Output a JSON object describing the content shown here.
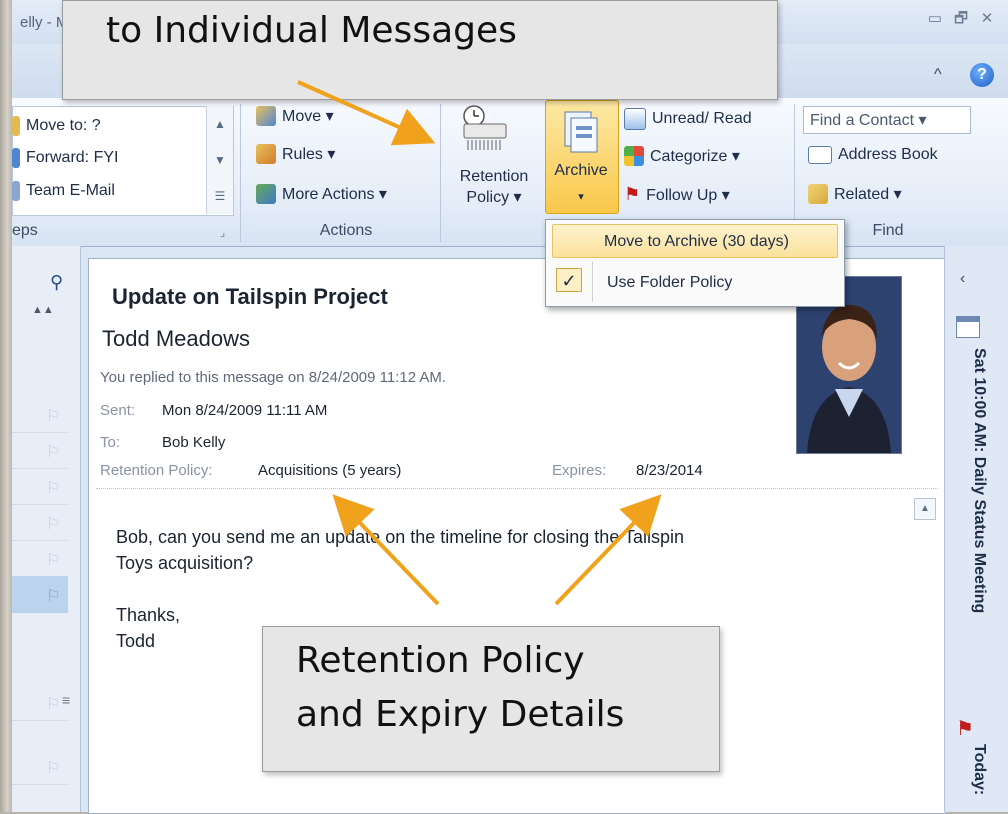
{
  "window": {
    "title_partial": "elly - Microsoft Outlook",
    "minimize_glyph": "▭",
    "restore_glyph": "🗗",
    "close_glyph": "✕",
    "help_glyph": "?",
    "collapse_glyph": "^"
  },
  "ribbon": {
    "quick_steps": {
      "items": [
        "Move to: ?",
        "Forward: FYI",
        "Team E-Mail"
      ],
      "group_label": "eps"
    },
    "actions": {
      "items": [
        "Move ▾",
        "Rules ▾",
        "More Actions ▾"
      ],
      "group_label": "Actions"
    },
    "retention_policy": {
      "line1": "Retention",
      "line2": "Policy ▾"
    },
    "archive": {
      "label": "Archive",
      "arrow": "▾"
    },
    "tags": {
      "items": [
        "Unread/ Read",
        "Categorize ▾",
        "Follow Up ▾"
      ]
    },
    "find": {
      "contact_box": "Find a Contact ▾",
      "items": [
        "Address Book",
        "Related ▾"
      ],
      "group_label": "Find"
    }
  },
  "archive_menu": {
    "item1": "Move to Archive (30 days)",
    "item2": "Use Folder Policy",
    "check_glyph": "✓"
  },
  "message": {
    "subject": "Update on Tailspin Project",
    "sender": "Todd Meadows",
    "reply_note": "You replied to this message on 8/24/2009 11:12 AM.",
    "sent_label": "Sent:",
    "sent_value": "Mon 8/24/2009 11:11 AM",
    "to_label": "To:",
    "to_value": "Bob Kelly",
    "retention_label": "Retention Policy:",
    "retention_value": "Acquisitions (5 years)",
    "expires_label": "Expires:",
    "expires_value": "8/23/2014",
    "body_line1": "Bob, can you send me an update on the timeline for closing the Tailspin",
    "body_line2": "Toys acquisition?",
    "body_line3": "Thanks,",
    "body_line4": "Todd"
  },
  "todo_bar": {
    "appointment": "Sat 10:00 AM: Daily Status Meeting",
    "today": "Today:"
  },
  "callouts": {
    "top": "to Individual Messages",
    "bottom_line1": "Retention Policy",
    "bottom_line2": "and Expiry Details"
  },
  "colors": {
    "archive_highlight": "#f9c84a",
    "callout_arrow": "#f0a21c",
    "flag_red": "#c21b1b"
  }
}
